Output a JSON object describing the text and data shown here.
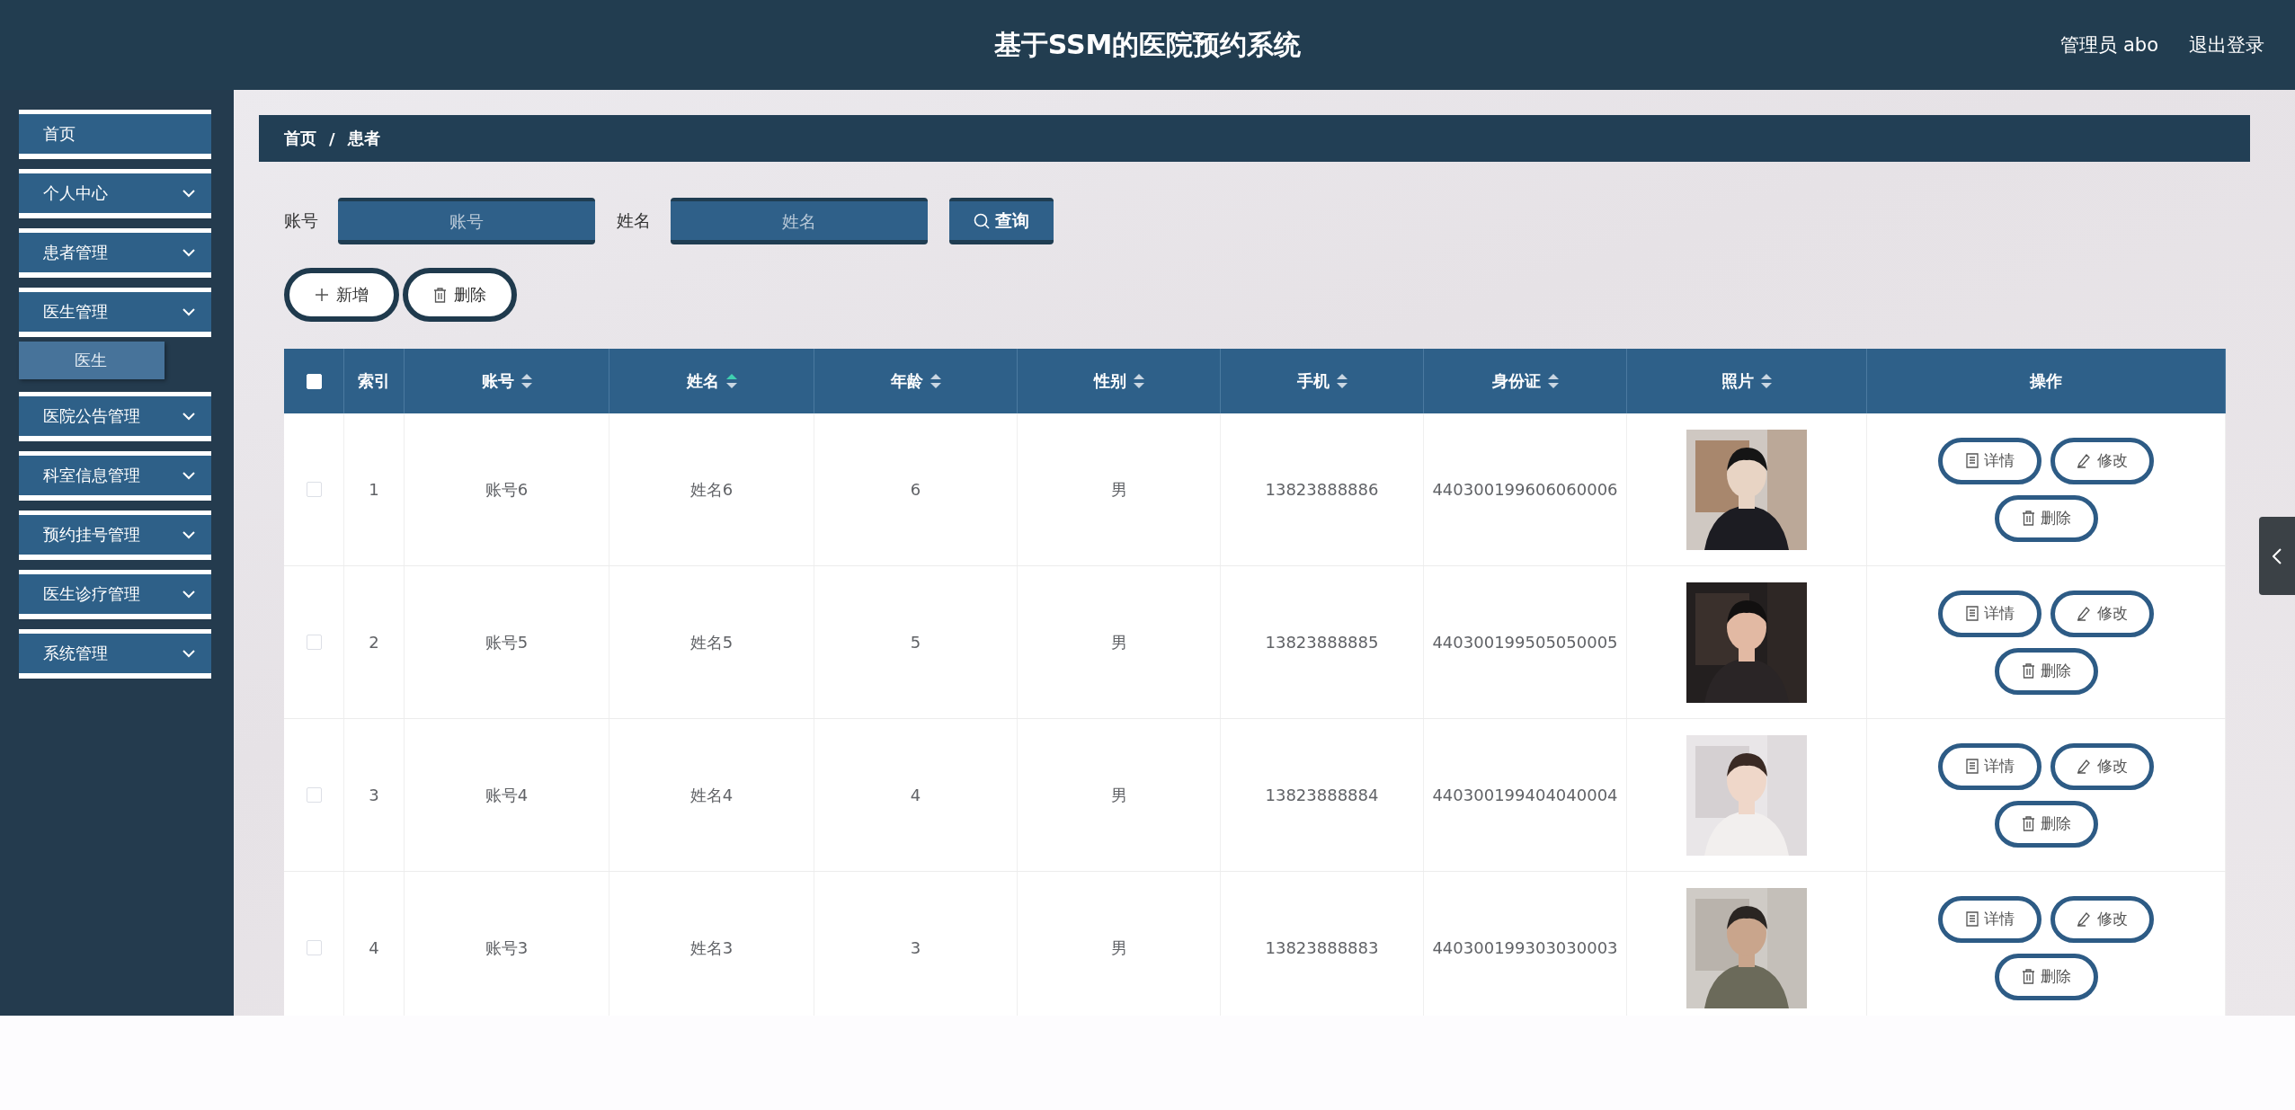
{
  "header": {
    "title": "基于SSM的医院预约系统",
    "user": "管理员 abo",
    "logout": "退出登录"
  },
  "sidebar": {
    "items": [
      {
        "label": "首页",
        "kind": "link"
      },
      {
        "label": "个人中心",
        "kind": "menu"
      },
      {
        "label": "患者管理",
        "kind": "menu"
      },
      {
        "label": "医生管理",
        "kind": "menu",
        "children": [
          {
            "label": "医生"
          }
        ]
      },
      {
        "label": "医院公告管理",
        "kind": "menu"
      },
      {
        "label": "科室信息管理",
        "kind": "menu"
      },
      {
        "label": "预约挂号管理",
        "kind": "menu"
      },
      {
        "label": "医生诊疗管理",
        "kind": "menu"
      },
      {
        "label": "系统管理",
        "kind": "menu"
      }
    ]
  },
  "breadcrumb": {
    "items": [
      "首页",
      "患者"
    ],
    "separator": "/"
  },
  "search": {
    "fields": [
      {
        "label": "账号",
        "placeholder": "账号"
      },
      {
        "label": "姓名",
        "placeholder": "姓名"
      }
    ],
    "button": "查询"
  },
  "actions": [
    {
      "kind": "add",
      "label": "新增"
    },
    {
      "kind": "delete",
      "label": "删除"
    }
  ],
  "table": {
    "select_all": {
      "checked": false
    },
    "columns": [
      {
        "label": "索引",
        "sortable": false
      },
      {
        "label": "账号",
        "sortable": true,
        "sorted": false
      },
      {
        "label": "姓名",
        "sortable": true,
        "sorted": true
      },
      {
        "label": "年龄",
        "sortable": true,
        "sorted": false
      },
      {
        "label": "性别",
        "sortable": true,
        "sorted": false
      },
      {
        "label": "手机",
        "sortable": true,
        "sorted": false
      },
      {
        "label": "身份证",
        "sortable": true,
        "sorted": false
      },
      {
        "label": "照片",
        "sortable": true,
        "sorted": false
      },
      {
        "label": "操作",
        "sortable": false
      }
    ],
    "rows": [
      {
        "checked": false,
        "cells": [
          "1",
          "账号6",
          "姓名6",
          "6",
          "男",
          "13823888886",
          "440300199606060006"
        ],
        "photo": {
          "kind": "picture"
        },
        "actions": [
          {
            "kind": "detail",
            "label": "详情"
          },
          {
            "kind": "edit",
            "label": "修改"
          },
          {
            "kind": "delete",
            "label": "删除"
          }
        ]
      },
      {
        "checked": false,
        "cells": [
          "2",
          "账号5",
          "姓名5",
          "5",
          "男",
          "13823888885",
          "440300199505050005"
        ],
        "photo": {
          "kind": "picture"
        },
        "actions": [
          {
            "kind": "detail",
            "label": "详情"
          },
          {
            "kind": "edit",
            "label": "修改"
          },
          {
            "kind": "delete",
            "label": "删除"
          }
        ]
      },
      {
        "checked": false,
        "cells": [
          "3",
          "账号4",
          "姓名4",
          "4",
          "男",
          "13823888884",
          "440300199404040004"
        ],
        "photo": {
          "kind": "picture"
        },
        "actions": [
          {
            "kind": "detail",
            "label": "详情"
          },
          {
            "kind": "edit",
            "label": "修改"
          },
          {
            "kind": "delete",
            "label": "删除"
          }
        ]
      },
      {
        "checked": false,
        "cells": [
          "4",
          "账号3",
          "姓名3",
          "3",
          "男",
          "13823888883",
          "440300199303030003"
        ],
        "photo": {
          "kind": "picture"
        },
        "actions": [
          {
            "kind": "detail",
            "label": "详情"
          },
          {
            "kind": "edit",
            "label": "修改"
          },
          {
            "kind": "delete",
            "label": "删除"
          }
        ]
      }
    ]
  }
}
